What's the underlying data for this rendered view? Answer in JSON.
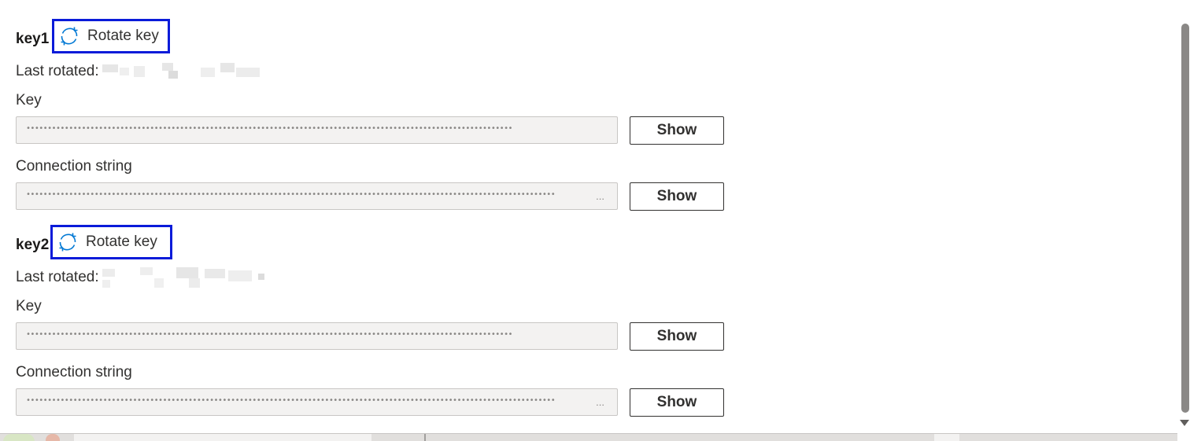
{
  "keys": [
    {
      "name": "key1",
      "rotate_label": "Rotate key",
      "last_rotated_label": "Last rotated:",
      "key_label": "Key",
      "key_value": "••••••••••••••••••••••••••••••••••••••••••••••••••••••••••••••••••••••••••••••••••••••••••••••••••••••••••••••••••",
      "show_key_label": "Show",
      "connection_label": "Connection string",
      "connection_value": "••••••••••••••••••••••••••••••••••••••••••••••••••••••••••••••••••••••••••••••••••••••••••••••••••••••••••••••••••••••••••••",
      "connection_ellipsis": "...",
      "show_connection_label": "Show"
    },
    {
      "name": "key2",
      "rotate_label": "Rotate key",
      "last_rotated_label": "Last rotated:",
      "key_label": "Key",
      "key_value": "••••••••••••••••••••••••••••••••••••••••••••••••••••••••••••••••••••••••••••••••••••••••••••••••••••••••••••••••••",
      "show_key_label": "Show",
      "connection_label": "Connection string",
      "connection_value": "••••••••••••••••••••••••••••••••••••••••••••••••••••••••••••••••••••••••••••••••••••••••••••••••••••••••••••••••••••••••••••",
      "connection_ellipsis": "...",
      "show_connection_label": "Show"
    }
  ],
  "colors": {
    "highlight_border": "#0a1bd9",
    "rotate_icon": "#0078d4",
    "field_background": "#f3f2f1"
  },
  "icons": {
    "rotate": "refresh-icon"
  }
}
